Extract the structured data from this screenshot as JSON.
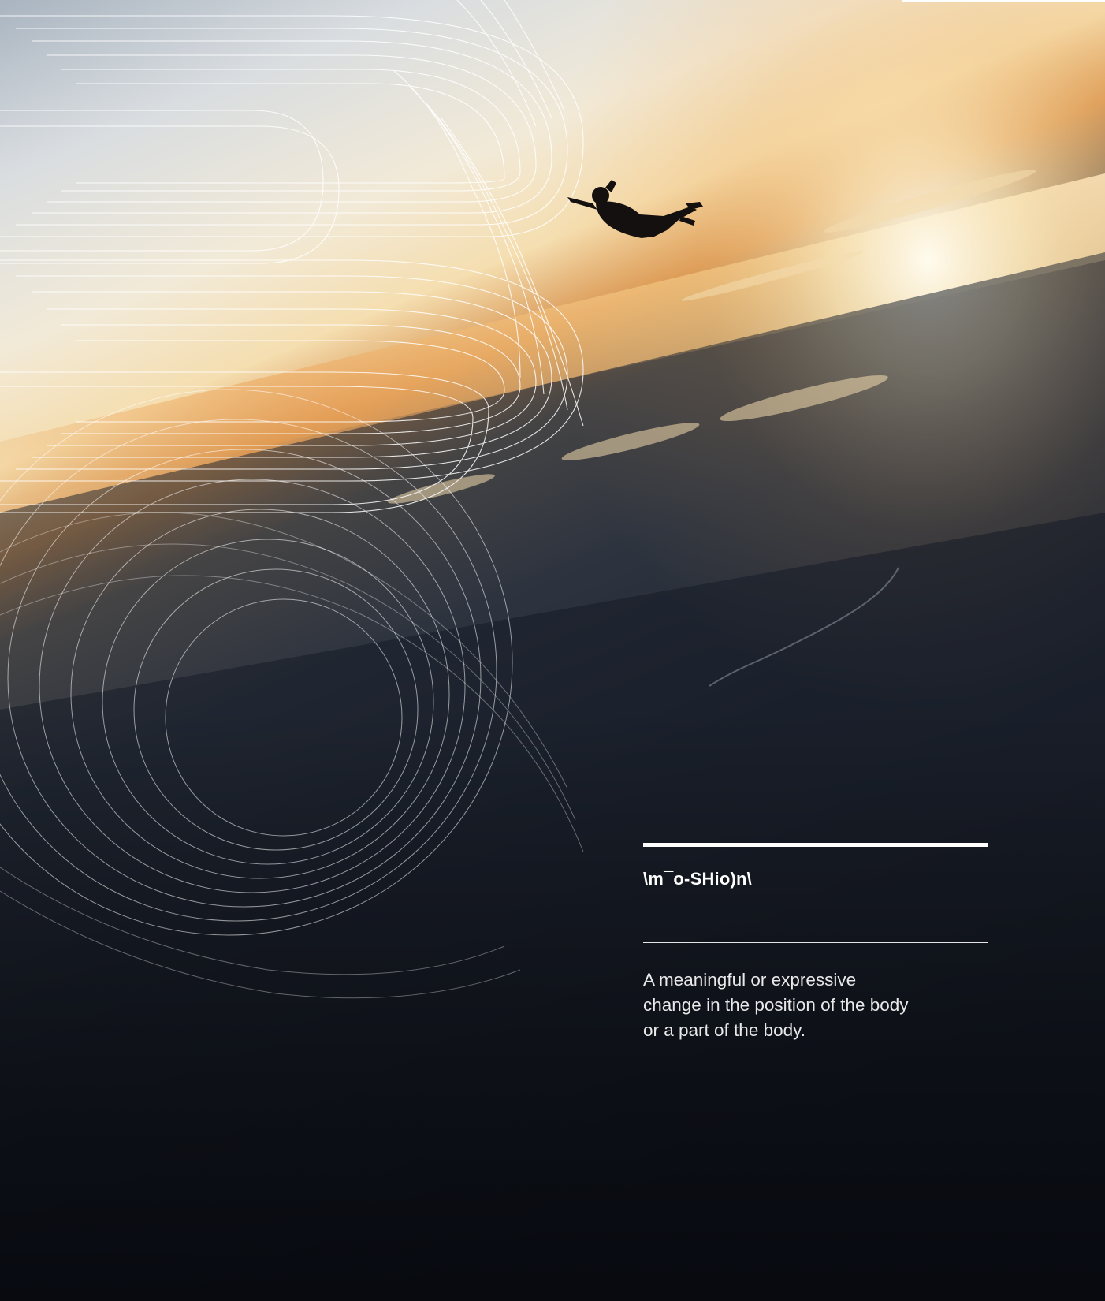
{
  "definition": {
    "pronunciation": "\\m¯o-SHio)n\\",
    "meaning": "A meaningful or expressive change in the position of the body or a part of the body."
  },
  "palette": {
    "sky_top": "#b9c3cd",
    "sky_glow": "#f3e7cf",
    "horizon_orange": "#e9a55a",
    "sun": "#fff8e6",
    "ground_dark": "#0d111a",
    "line_color": "#ffffff",
    "text_color": "#ffffff"
  },
  "icons": {
    "figure": "skydiver-silhouette",
    "decoration": "concentric-line-pattern"
  }
}
